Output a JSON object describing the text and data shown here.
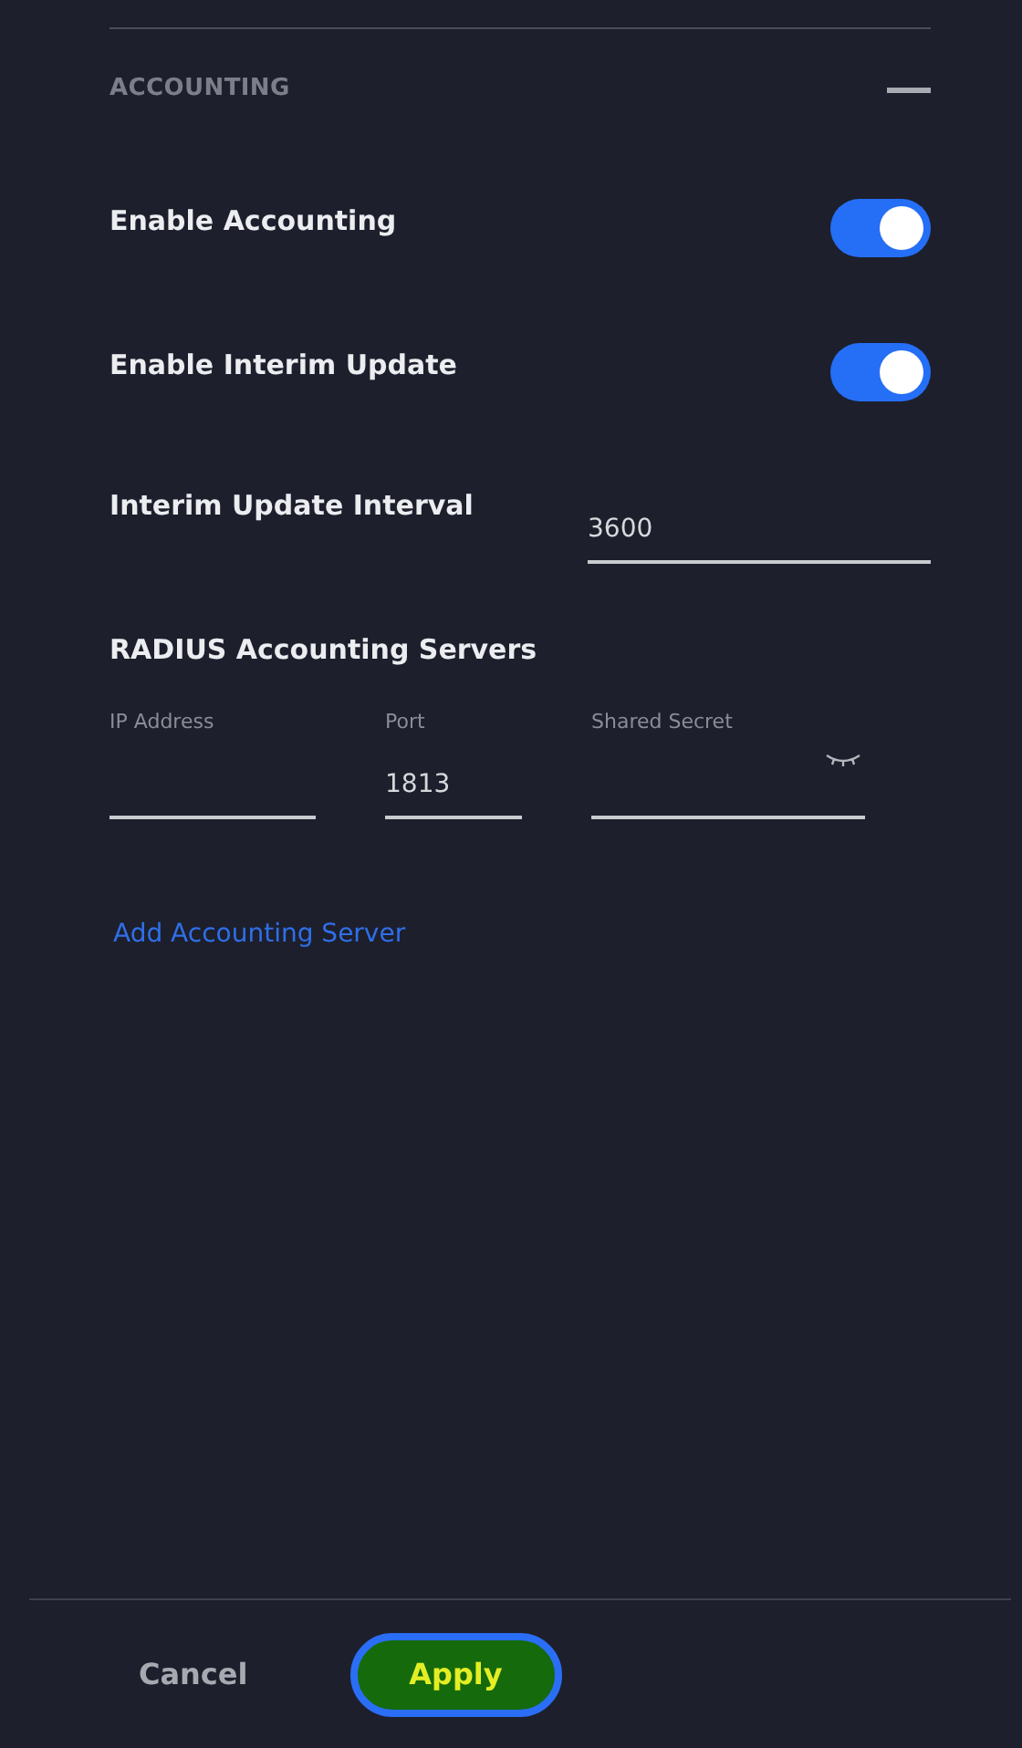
{
  "section": {
    "title": "ACCOUNTING",
    "expanded": true
  },
  "toggles": [
    {
      "label": "Enable Accounting",
      "on": true
    },
    {
      "label": "Enable Interim Update",
      "on": true
    }
  ],
  "interval": {
    "label": "Interim Update Interval",
    "value": "3600"
  },
  "servers": {
    "heading": "RADIUS Accounting Servers",
    "fields": [
      {
        "kind": "text",
        "label": "IP Address"
      },
      {
        "kind": "text",
        "label": "Port",
        "value": "1813"
      },
      {
        "kind": "secret",
        "label": "Shared Secret"
      }
    ],
    "add_link": "Add Accounting Server"
  },
  "footer": {
    "buttons": [
      {
        "label": "Cancel",
        "kind": "secondary"
      },
      {
        "label": "Apply",
        "kind": "primary"
      }
    ]
  }
}
